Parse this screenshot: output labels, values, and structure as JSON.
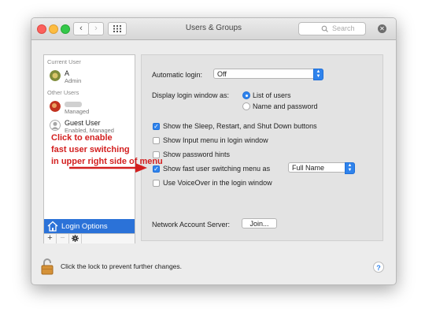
{
  "window": {
    "title": "Users & Groups",
    "search_placeholder": "Search",
    "nav": {
      "back_icon": "‹",
      "forward_icon": "›"
    }
  },
  "sidebar": {
    "current_user_label": "Current User",
    "other_users_label": "Other Users",
    "users": [
      {
        "name": "A",
        "role": "Admin"
      },
      {
        "name": "",
        "role": "Managed"
      },
      {
        "name": "Guest User",
        "role": "Enabled, Managed"
      }
    ],
    "login_options_label": "Login Options",
    "add_label": "+",
    "remove_label": "−"
  },
  "main": {
    "automatic_login_label": "Automatic login:",
    "automatic_login_value": "Off",
    "display_login_label": "Display login window as:",
    "radio_list_label": "List of users",
    "radio_name_label": "Name and password",
    "cb_sleep_label": "Show the Sleep, Restart, and Shut Down buttons",
    "cb_input_menu_label": "Show Input menu in login window",
    "cb_password_hints_label": "Show password hints",
    "cb_fast_switch_label": "Show fast user switching menu as",
    "fast_switch_value": "Full Name",
    "cb_voiceover_label": "Use VoiceOver in the login window",
    "network_label": "Network Account Server:",
    "join_label": "Join..."
  },
  "footer": {
    "lock_text": "Click the lock to prevent further changes.",
    "help_label": "?"
  },
  "annotation": {
    "line1": "Click to enable",
    "line2": "fast user switching",
    "line3": "in upper right side of menu"
  },
  "colors": {
    "accent": "#2f83ec",
    "annotation": "#d31f1f",
    "selection": "#2b72d8"
  }
}
